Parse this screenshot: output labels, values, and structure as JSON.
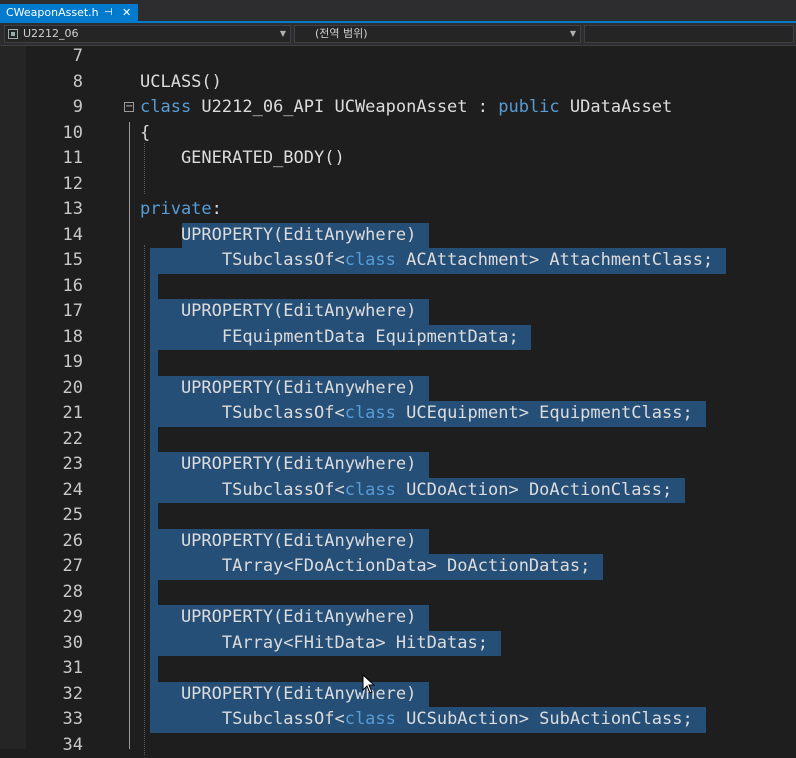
{
  "tab": {
    "title": "CWeaponAsset.h",
    "pin_glyph": "⊣",
    "close_glyph": "✕"
  },
  "navigation": {
    "project": "U2212_06",
    "scope": "(전역 범위)",
    "member": ""
  },
  "lines": [
    {
      "num": "7",
      "tokens": []
    },
    {
      "num": "8",
      "tokens": [
        {
          "t": "UCLASS()"
        }
      ]
    },
    {
      "num": "9",
      "fold": "−",
      "tokens": [
        {
          "t": "class",
          "k": "kw"
        },
        {
          "t": " U2212_06_API UCWeaponAsset : "
        },
        {
          "t": "public",
          "k": "kw"
        },
        {
          "t": " UDataAsset"
        }
      ]
    },
    {
      "num": "10",
      "tokens": [
        {
          "t": "{"
        }
      ]
    },
    {
      "num": "11",
      "tokens": [
        {
          "t": "    GENERATED_BODY()"
        }
      ]
    },
    {
      "num": "12",
      "tokens": []
    },
    {
      "num": "13",
      "tokens": [
        {
          "t": "private",
          "k": "kw"
        },
        {
          "t": ":"
        }
      ]
    },
    {
      "num": "14",
      "sel": true,
      "tokens": [
        {
          "t": "    UPROPERTY(EditAnywhere)"
        }
      ]
    },
    {
      "num": "15",
      "sel": true,
      "tokens": [
        {
          "t": "        TSubclassOf<"
        },
        {
          "t": "class",
          "k": "kw"
        },
        {
          "t": " ACAttachment> AttachmentClass;"
        }
      ]
    },
    {
      "num": "16",
      "sel": true,
      "tokens": []
    },
    {
      "num": "17",
      "sel": true,
      "tokens": [
        {
          "t": "    UPROPERTY(EditAnywhere)"
        }
      ]
    },
    {
      "num": "18",
      "sel": true,
      "tokens": [
        {
          "t": "        FEquipmentData EquipmentData;"
        }
      ]
    },
    {
      "num": "19",
      "sel": true,
      "tokens": []
    },
    {
      "num": "20",
      "sel": true,
      "tokens": [
        {
          "t": "    UPROPERTY(EditAnywhere)"
        }
      ]
    },
    {
      "num": "21",
      "sel": true,
      "tokens": [
        {
          "t": "        TSubclassOf<"
        },
        {
          "t": "class",
          "k": "kw"
        },
        {
          "t": " UCEquipment> EquipmentClass;"
        }
      ]
    },
    {
      "num": "22",
      "sel": true,
      "tokens": []
    },
    {
      "num": "23",
      "sel": true,
      "tokens": [
        {
          "t": "    UPROPERTY(EditAnywhere)"
        }
      ]
    },
    {
      "num": "24",
      "sel": true,
      "tokens": [
        {
          "t": "        TSubclassOf<"
        },
        {
          "t": "class",
          "k": "kw"
        },
        {
          "t": " UCDoAction> DoActionClass;"
        }
      ]
    },
    {
      "num": "25",
      "sel": true,
      "tokens": []
    },
    {
      "num": "26",
      "sel": true,
      "tokens": [
        {
          "t": "    UPROPERTY(EditAnywhere)"
        }
      ]
    },
    {
      "num": "27",
      "sel": true,
      "tokens": [
        {
          "t": "        TArray<FDoActionData> DoActionDatas;"
        }
      ]
    },
    {
      "num": "28",
      "sel": true,
      "tokens": []
    },
    {
      "num": "29",
      "sel": true,
      "tokens": [
        {
          "t": "    UPROPERTY(EditAnywhere)"
        }
      ]
    },
    {
      "num": "30",
      "sel": true,
      "tokens": [
        {
          "t": "        TArray<FHitData> HitDatas;"
        }
      ]
    },
    {
      "num": "31",
      "sel": true,
      "tokens": []
    },
    {
      "num": "32",
      "sel": true,
      "tokens": [
        {
          "t": "    UPROPERTY(EditAnywhere)"
        }
      ]
    },
    {
      "num": "33",
      "sel": true,
      "tokens": [
        {
          "t": "        TSubclassOf<"
        },
        {
          "t": "class",
          "k": "kw"
        },
        {
          "t": " UCSubAction> SubActionClass;"
        }
      ]
    },
    {
      "num": "34",
      "tokens": []
    }
  ],
  "colors": {
    "background": "#1e1e1e",
    "keyword": "#569cd6",
    "text": "#dcdcdc",
    "selection": "#264f78",
    "tab_active": "#007acc"
  },
  "icons": {
    "mouse_pointer": "arrow-cursor-icon",
    "project": "project-icon"
  }
}
